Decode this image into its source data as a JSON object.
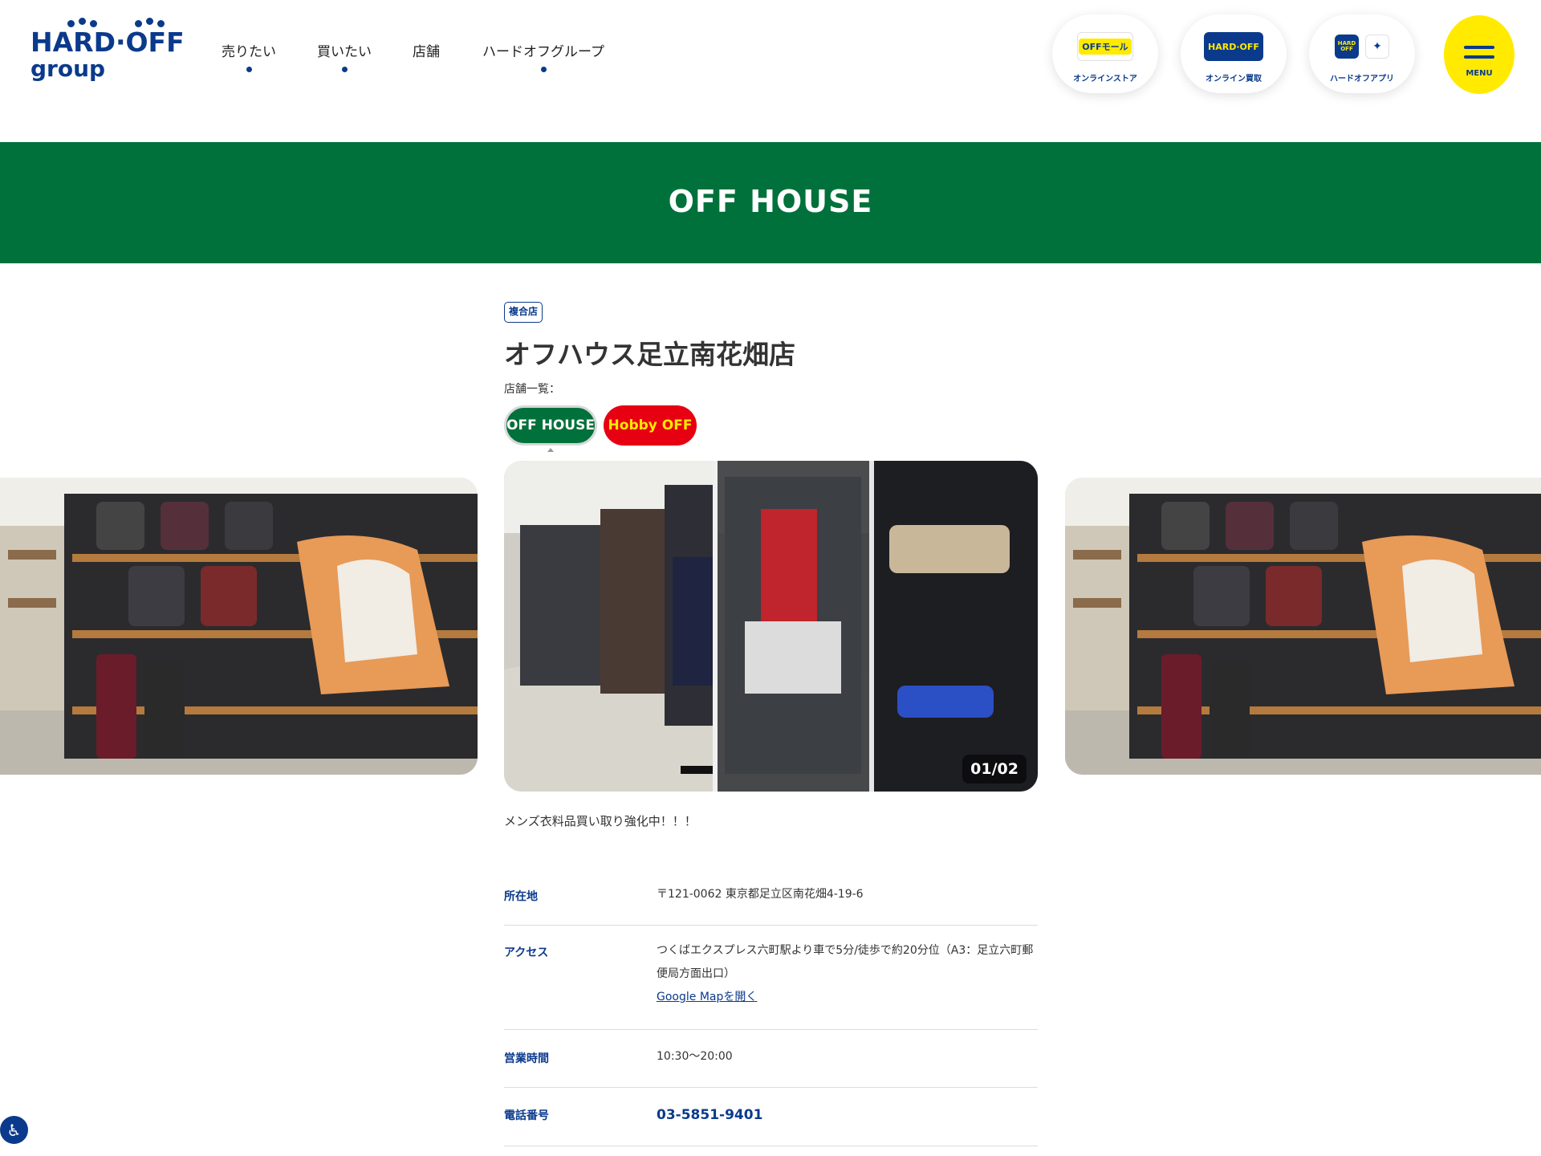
{
  "header": {
    "logo_top": "HARD·OFF",
    "logo_bottom": "group",
    "nav": [
      {
        "label": "売りたい"
      },
      {
        "label": "買いたい"
      },
      {
        "label": "店舗"
      },
      {
        "label": "ハードオフグループ"
      }
    ],
    "services": [
      {
        "icon_text": "OFFモール",
        "label": "オンラインストア"
      },
      {
        "icon_text": "HARD·OFF",
        "label": "オンライン買取"
      },
      {
        "icon_text": "HARD OFF",
        "label": "ハードオフアプリ"
      }
    ],
    "menu_label": "MENU"
  },
  "band": {
    "brand_logo": "OFF HOUSE"
  },
  "store": {
    "badge": "複合店",
    "title": "オフハウス足立南花畑店",
    "store_list_label": "店舗一覧：",
    "brands": [
      {
        "label": "OFF HOUSE"
      },
      {
        "label": "Hobby OFF"
      }
    ],
    "carousel": {
      "counter": "01/02"
    },
    "comment": "メンズ衣料品買い取り強化中！！！",
    "info": {
      "address_key": "所在地",
      "address_value": "〒121-0062 東京都足立区南花畑4-19-6",
      "access_key": "アクセス",
      "access_value": "つくばエクスプレス六町駅より車で5分/徒歩で約20分位（A3：足立六町郵便局方面出口）",
      "map_link": "Google Mapを開く",
      "hours_key": "営業時間",
      "hours_value": "10:30〜20:00",
      "phone_key": "電話番号",
      "phone_value": "03-5851-9401"
    }
  },
  "colors": {
    "brand_blue": "#0b3a8c",
    "brand_green": "#00713b",
    "brand_yellow": "#ffea00",
    "hobby_red": "#e60012"
  }
}
